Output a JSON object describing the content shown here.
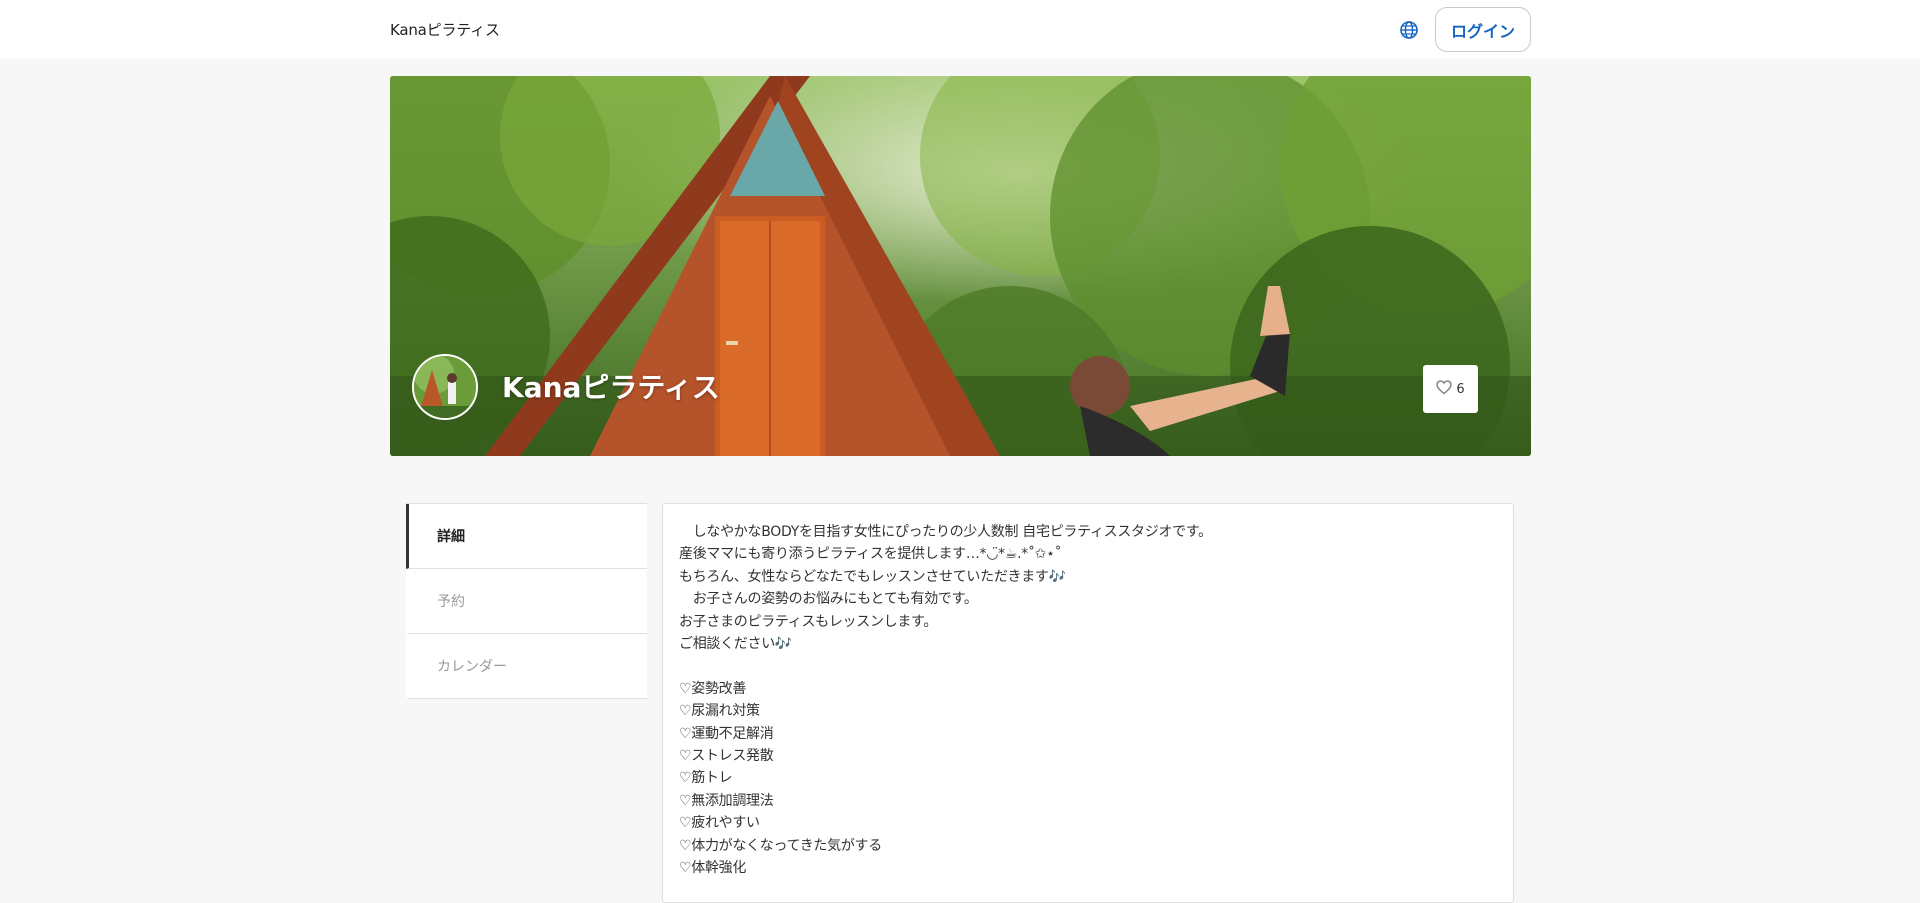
{
  "header": {
    "brand": "Kanaピラティス",
    "login_label": "ログイン",
    "globe_icon": "globe-icon",
    "accent": "#1565c0"
  },
  "hero": {
    "title": "Kanaピラティス",
    "like_count": "6",
    "like_icon": "heart-outline-icon"
  },
  "nav": {
    "items": [
      {
        "label": "詳細",
        "active": true
      },
      {
        "label": "予約",
        "active": false
      },
      {
        "label": "カレンダー",
        "active": false
      }
    ]
  },
  "description": {
    "lines": [
      "　しなやかなBODYを目指す女性にぴったりの少人数制 自宅ピラティススタジオです。",
      "産後ママにも寄り添うピラティスを提供します…*◡̈*☕︎.*˚✩⋆˚",
      "もちろん、女性ならどなたでもレッスンさせていただきます🎶",
      "　お子さんの姿勢のお悩みにもとても有効です。",
      "お子さまのピラティスもレッスンします。",
      "ご相談ください🎶",
      "",
      "♡姿勢改善",
      "♡尿漏れ対策",
      "♡運動不足解消",
      "♡ストレス発散",
      "♡筋トレ",
      "♡無添加調理法",
      "♡疲れやすい",
      "♡体力がなくなってきた気がする",
      "♡体幹強化"
    ]
  }
}
